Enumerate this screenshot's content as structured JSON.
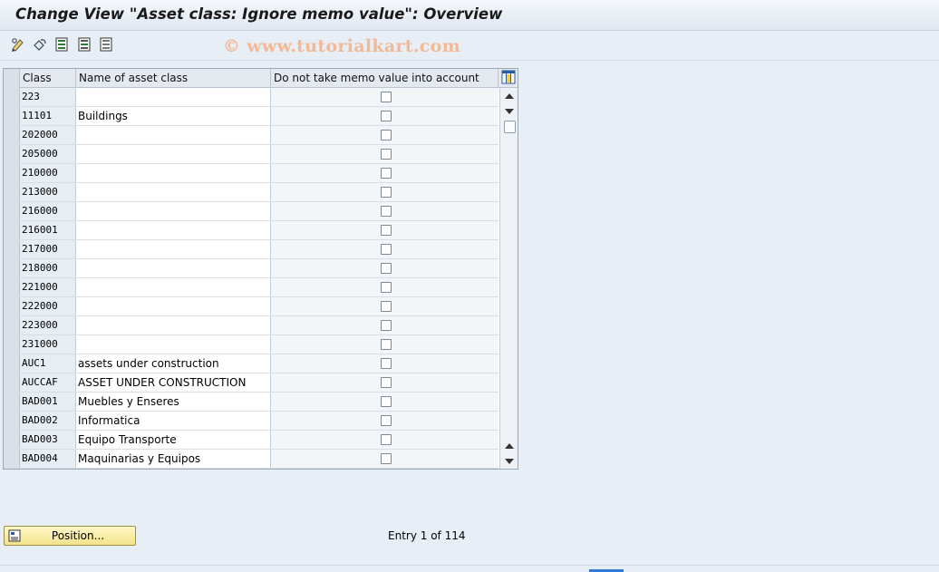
{
  "window": {
    "title": "Change View \"Asset class: Ignore memo value\": Overview"
  },
  "toolbar": {
    "icons": [
      "display-change-icon",
      "undo-icon",
      "select-all-icon",
      "select-block-icon",
      "deselect-all-icon"
    ],
    "watermark": "© www.tutorialkart.com"
  },
  "table": {
    "columns": [
      "Class",
      "Name of asset class",
      "Do not take memo value into account"
    ],
    "rows": [
      {
        "class": "223",
        "name": "",
        "checked": false
      },
      {
        "class": "11101",
        "name": "Buildings",
        "checked": false
      },
      {
        "class": "202000",
        "name": "",
        "checked": false
      },
      {
        "class": "205000",
        "name": "",
        "checked": false
      },
      {
        "class": "210000",
        "name": "",
        "checked": false
      },
      {
        "class": "213000",
        "name": "",
        "checked": false
      },
      {
        "class": "216000",
        "name": "",
        "checked": false
      },
      {
        "class": "216001",
        "name": "",
        "checked": false
      },
      {
        "class": "217000",
        "name": "",
        "checked": false
      },
      {
        "class": "218000",
        "name": "",
        "checked": false
      },
      {
        "class": "221000",
        "name": "",
        "checked": false
      },
      {
        "class": "222000",
        "name": "",
        "checked": false
      },
      {
        "class": "223000",
        "name": "",
        "checked": false
      },
      {
        "class": "231000",
        "name": "",
        "checked": false
      },
      {
        "class": "AUC1",
        "name": "assets under construction",
        "checked": false
      },
      {
        "class": "AUCCAF",
        "name": "ASSET UNDER CONSTRUCTION",
        "checked": false
      },
      {
        "class": "BAD001",
        "name": "Muebles y Enseres",
        "checked": false
      },
      {
        "class": "BAD002",
        "name": "Informatica",
        "checked": false
      },
      {
        "class": "BAD003",
        "name": "Equipo  Transporte",
        "checked": false
      },
      {
        "class": "BAD004",
        "name": "Maquinarias y Equipos",
        "checked": false
      }
    ]
  },
  "footer": {
    "position_button": "Position...",
    "entry_text": "Entry 1 of 114"
  },
  "colors": {
    "background": "#e8eef5",
    "button_yellow": "#f3e28a",
    "watermark": "#f3b997"
  }
}
